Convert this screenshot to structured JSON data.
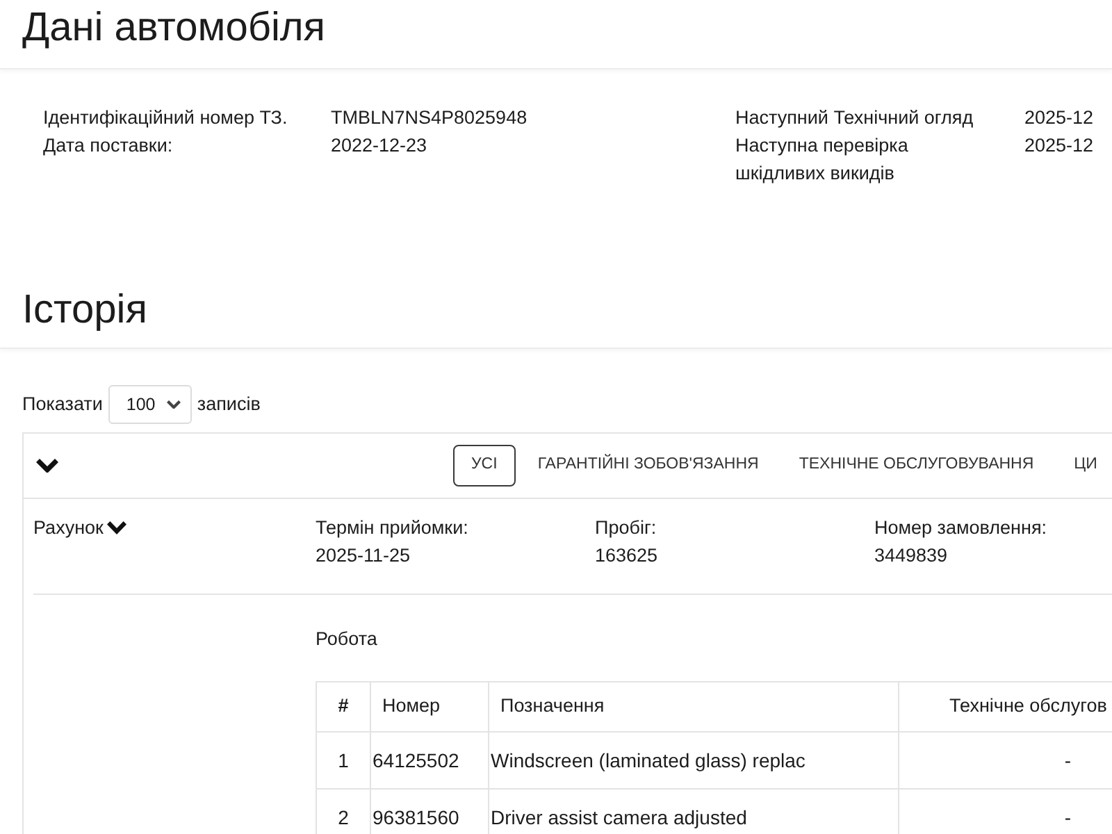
{
  "page_title": "Дані автомобіля",
  "vehicle_info": {
    "left": [
      {
        "label": "Ідентифікаційний номер ТЗ.",
        "value": "TMBLN7NS4P8025948"
      },
      {
        "label": "Дата поставки:",
        "value": "2022-12-23"
      }
    ],
    "right": [
      {
        "label": "Наступний Технічний огляд",
        "value": "2025-12"
      },
      {
        "label": "Наступна перевірка шкідливих викидів",
        "value": "2025-12"
      }
    ]
  },
  "history": {
    "title": "Історія",
    "show_entries": {
      "prefix": "Показати",
      "value": "100",
      "suffix": "записів"
    },
    "filter_tabs": [
      {
        "label": "УСІ",
        "selected": true
      },
      {
        "label": "ГАРАНТІЙНІ ЗОБОВ'ЯЗАННЯ",
        "selected": false
      },
      {
        "label": "ТЕХНІЧНЕ ОБСЛУГОВУВАННЯ",
        "selected": false
      },
      {
        "label": "ЦИ",
        "selected": false
      }
    ],
    "records": [
      {
        "invoice_label": "Рахунок",
        "fields": [
          {
            "label": "Термін прийомки:",
            "value": "2025-11-25"
          },
          {
            "label": "Пробіг:",
            "value": "163625"
          },
          {
            "label": "Номер замовлення:",
            "value": "3449839"
          }
        ],
        "work": {
          "title": "Робота",
          "table": {
            "columns": [
              "#",
              "Номер",
              "Позначення",
              "Технічне обслугов"
            ],
            "rows": [
              [
                "1",
                "64125502",
                "Windscreen (laminated glass) replac",
                "-"
              ],
              [
                "2",
                "96381560",
                "Driver assist camera adjusted",
                "-"
              ]
            ]
          }
        }
      }
    ]
  }
}
